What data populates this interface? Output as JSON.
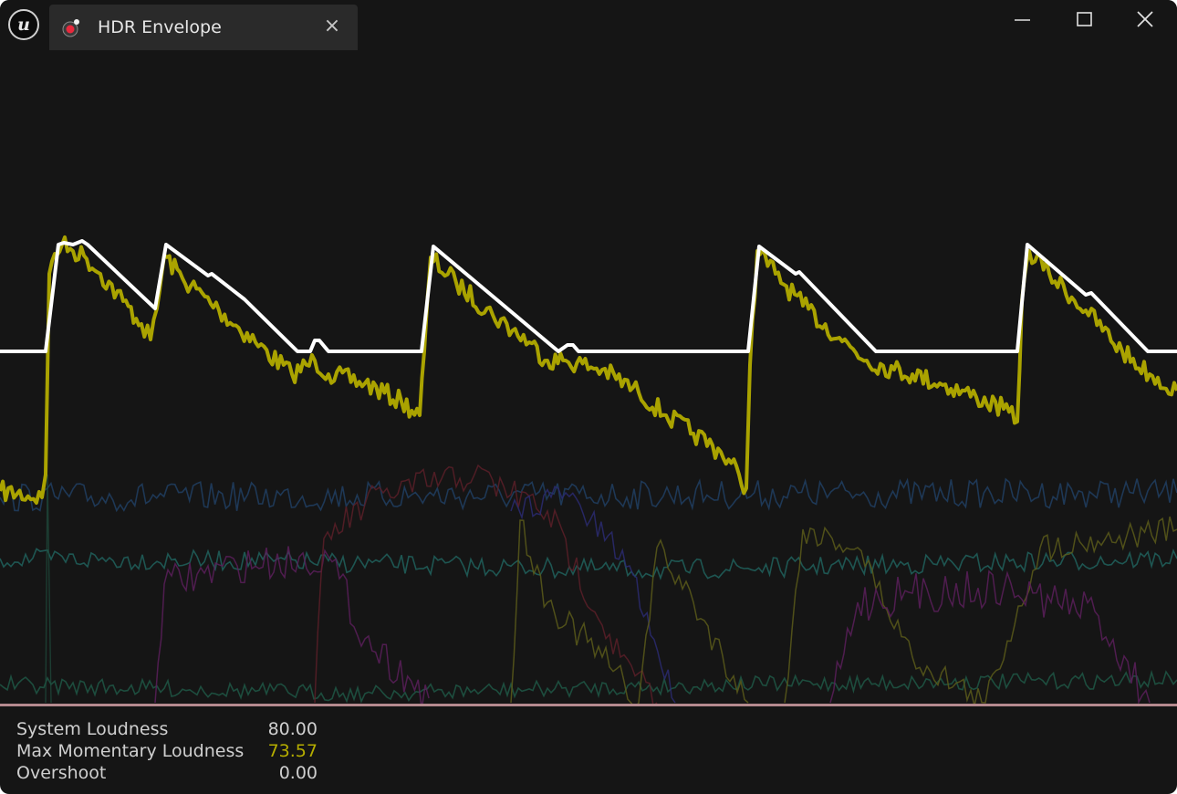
{
  "app": {
    "logo_icon": "unreal-engine-logo-icon"
  },
  "tab": {
    "title": "HDR Envelope",
    "icon": "hdr-record-icon",
    "close_label": "×"
  },
  "window_controls": {
    "minimize": "minimize-icon",
    "maximize": "maximize-icon",
    "close": "close-icon"
  },
  "stats": [
    {
      "label": "System Loudness",
      "value": "80.00",
      "color": "#cfcfcf"
    },
    {
      "label": "Max Momentary Loudness",
      "value": "73.57",
      "color": "#b5ad00"
    },
    {
      "label": "Overshoot",
      "value": "0.00",
      "color": "#cfcfcf"
    }
  ],
  "colors": {
    "background": "#151515",
    "envelope": "#ffffff",
    "momentary_loudness": "#aaa300",
    "baseline": "#b58a8f"
  }
}
